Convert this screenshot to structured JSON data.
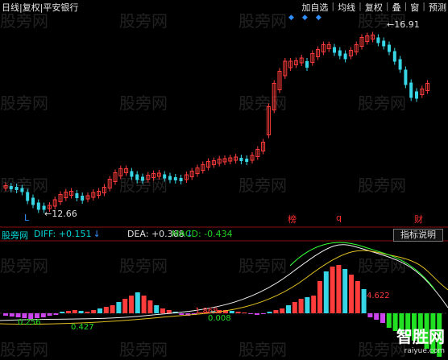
{
  "header": {
    "title": "日线|复权|平安银行",
    "menu": [
      "加自选",
      "均线",
      "复权",
      "叠",
      "窗",
      "预测"
    ]
  },
  "price": {
    "high_label": "16.91",
    "low_label": "12.66",
    "markers": [
      "L",
      "榜",
      "q",
      "财"
    ]
  },
  "macd": {
    "name": "股旁网",
    "diff_label": "DIFF:",
    "diff_value": "+0.151",
    "dea_label": "DEA:",
    "dea_value": "+0.368",
    "macd_label": "MACD:",
    "macd_value": "-0.434",
    "help_label": "指标说明",
    "inline_labels": [
      "4.622",
      "0.256",
      "0.427",
      "1.868",
      "0.008"
    ]
  },
  "watermark": "股旁网",
  "logo": {
    "text": "智胜网",
    "site": "raiyue.com"
  },
  "colors": {
    "up": "#ff3c3c",
    "down": "#36d6e6",
    "macd_neg": "#22e022",
    "arrow": "#2f8fff"
  }
}
